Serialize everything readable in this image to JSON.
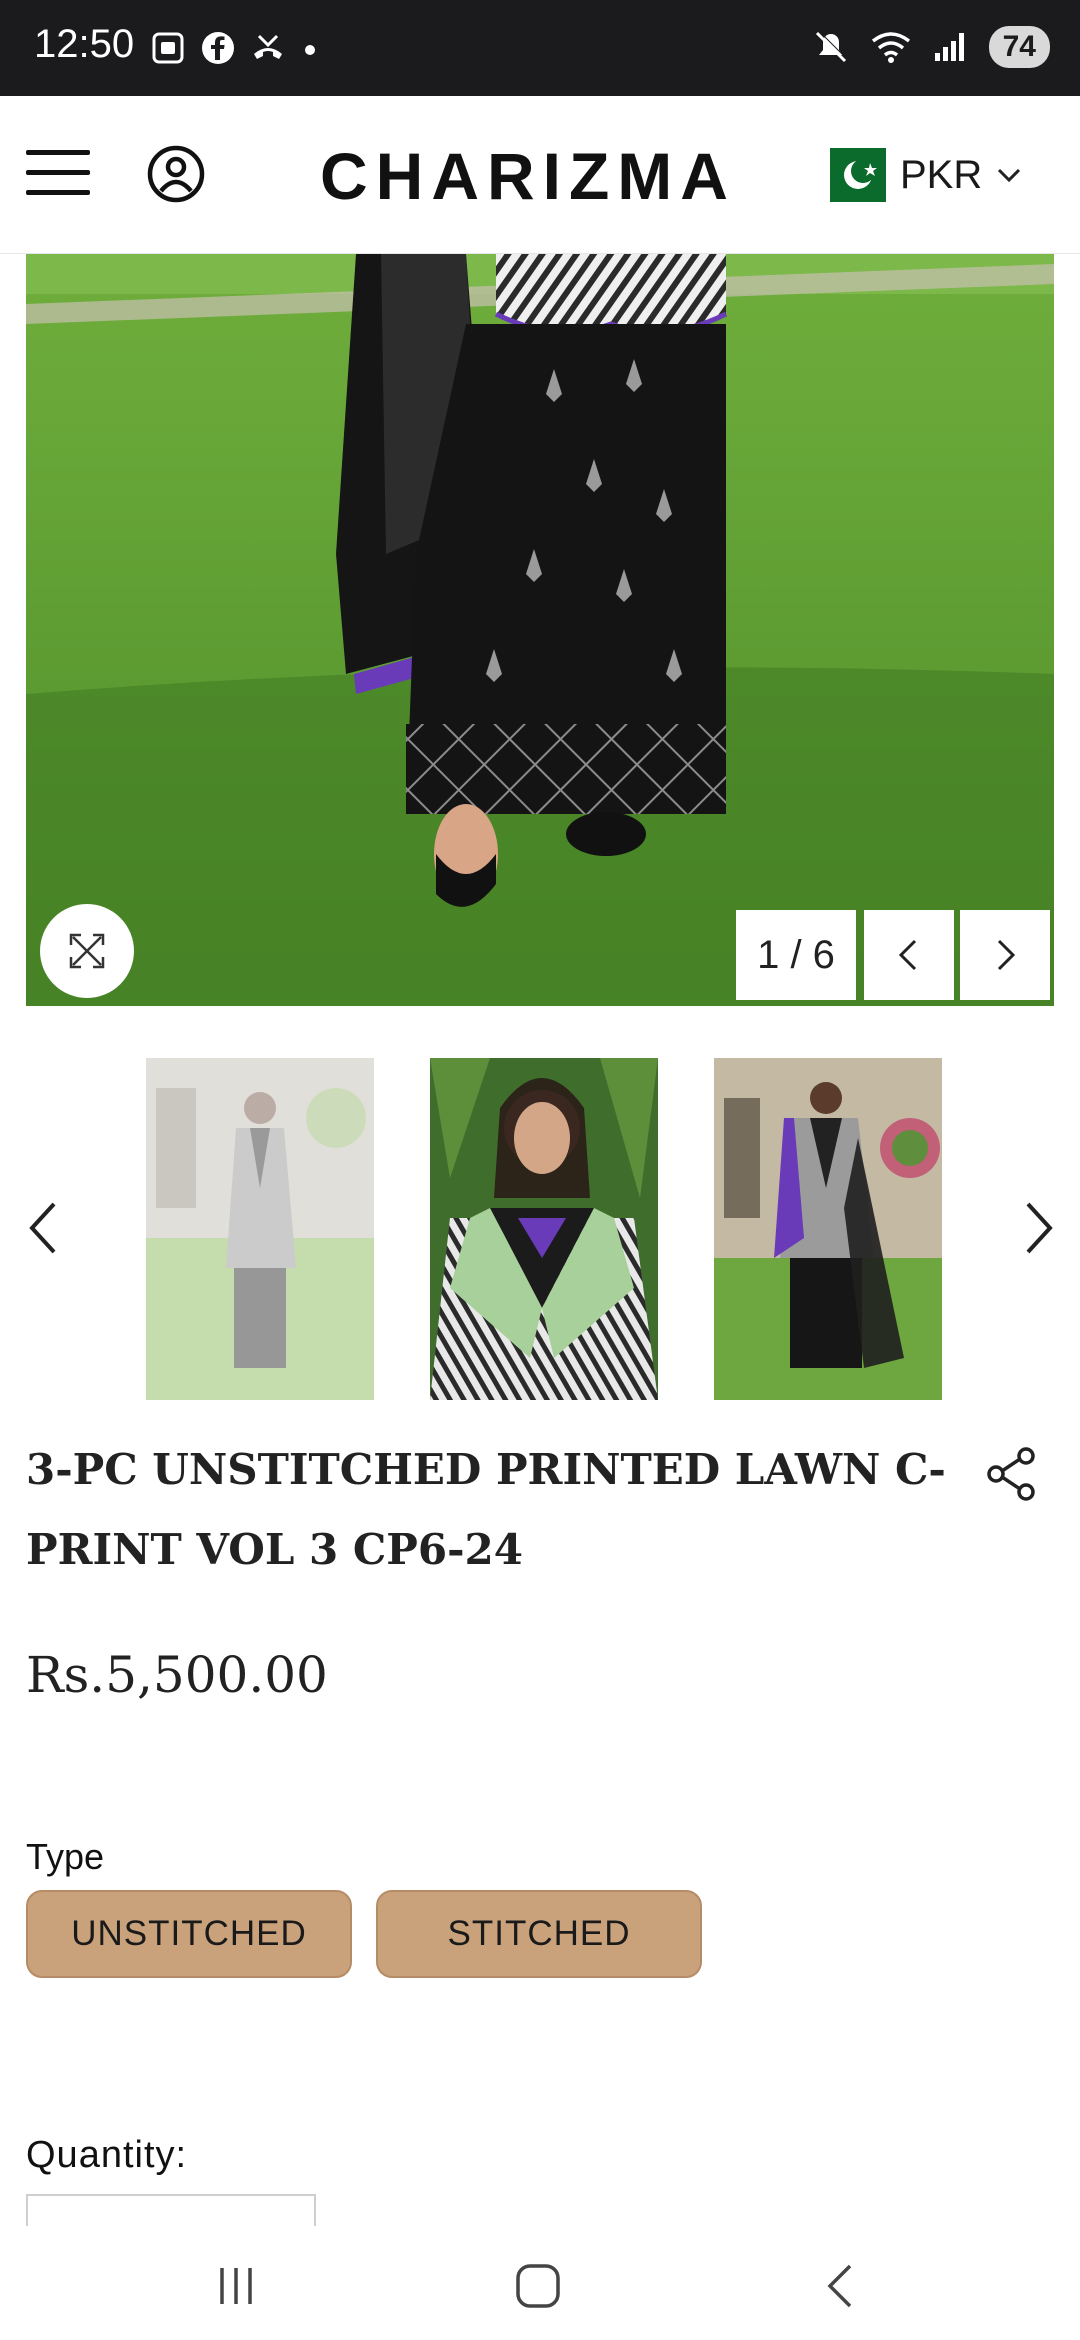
{
  "status_bar": {
    "time": "12:50",
    "battery": "74",
    "left_icons": [
      "screenshot-icon",
      "facebook-icon",
      "missed-call-icon",
      "dot-icon"
    ],
    "right_icons": [
      "mute-icon",
      "wifi-icon",
      "signal-icon"
    ]
  },
  "header": {
    "brand": "CHARIZMA",
    "currency": "PKR"
  },
  "gallery": {
    "counter": "1 / 6"
  },
  "product": {
    "title": "3-PC UNSTITCHED PRINTED LAWN C-PRINT VOL 3 CP6-24",
    "price": "Rs.5,500.00"
  },
  "options": {
    "type_label": "Type",
    "types": [
      "UNSTITCHED",
      "STITCHED"
    ],
    "quantity_label": "Quantity:"
  },
  "colors": {
    "accent_button": "#c9a27c",
    "status_bar_bg": "#1b1b1d",
    "flag_green": "#0b6b2d"
  }
}
